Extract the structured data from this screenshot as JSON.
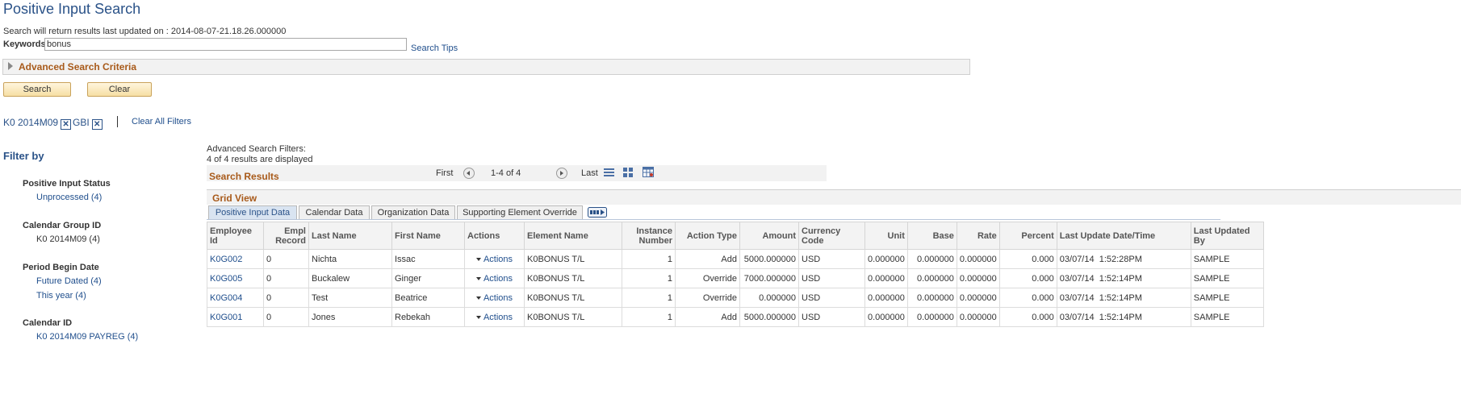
{
  "page_title": "Positive Input Search",
  "info_line": "Search will return results last updated on : 2014-08-07-21.18.26.000000",
  "keywords": {
    "label": "Keywords",
    "value": "bonus"
  },
  "search_tips": "Search Tips",
  "advanced_search_criteria": "Advanced Search Criteria",
  "buttons": {
    "search": "Search",
    "clear": "Clear"
  },
  "filter_chips": [
    "K0 2014M09",
    "GBI"
  ],
  "clear_all_filters": "Clear All Filters",
  "filter_by": {
    "title": "Filter by",
    "groups": [
      {
        "title": "Positive Input Status",
        "items": [
          "Unprocessed (4)"
        ]
      },
      {
        "title": "Calendar Group ID",
        "items": [
          "K0 2014M09 (4)"
        ]
      },
      {
        "title": "Period Begin Date",
        "items": [
          "Future Dated (4)",
          "This year (4)"
        ]
      },
      {
        "title": "Calendar ID",
        "items": [
          "K0 2014M09 PAYREG (4)"
        ]
      }
    ]
  },
  "advanced_filters_label": "Advanced Search Filters:",
  "results_count": "4 of 4 results are displayed",
  "results": {
    "title": "Search Results",
    "first": "First",
    "range": "1-4 of 4",
    "last": "Last"
  },
  "grid": {
    "title": "Grid View",
    "tabs": [
      "Positive Input Data",
      "Calendar Data",
      "Organization Data",
      "Supporting Element Override"
    ],
    "columns": [
      "Employee Id",
      "Empl Record",
      "Last Name",
      "First Name",
      "Actions",
      "Element Name",
      "Instance Number",
      "Action Type",
      "Amount",
      "Currency Code",
      "Unit",
      "Base",
      "Rate",
      "Percent",
      "Last Update Date/Time",
      "Last Updated By"
    ],
    "rows": [
      [
        "K0G002",
        "0",
        "Nichta",
        "Issac",
        "Actions",
        "K0BONUS T/L",
        "1",
        "Add",
        "5000.000000",
        "USD",
        "0.000000",
        "0.000000",
        "0.000000",
        "0.000",
        "03/07/14  1:52:28PM",
        "SAMPLE"
      ],
      [
        "K0G005",
        "0",
        "Buckalew",
        "Ginger",
        "Actions",
        "K0BONUS T/L",
        "1",
        "Override",
        "7000.000000",
        "USD",
        "0.000000",
        "0.000000",
        "0.000000",
        "0.000",
        "03/07/14  1:52:14PM",
        "SAMPLE"
      ],
      [
        "K0G004",
        "0",
        "Test",
        "Beatrice",
        "Actions",
        "K0BONUS T/L",
        "1",
        "Override",
        "0.000000",
        "USD",
        "0.000000",
        "0.000000",
        "0.000000",
        "0.000",
        "03/07/14  1:52:14PM",
        "SAMPLE"
      ],
      [
        "K0G001",
        "0",
        "Jones",
        "Rebekah",
        "Actions",
        "K0BONUS T/L",
        "1",
        "Add",
        "5000.000000",
        "USD",
        "0.000000",
        "0.000000",
        "0.000000",
        "0.000",
        "03/07/14  1:52:14PM",
        "SAMPLE"
      ]
    ]
  }
}
